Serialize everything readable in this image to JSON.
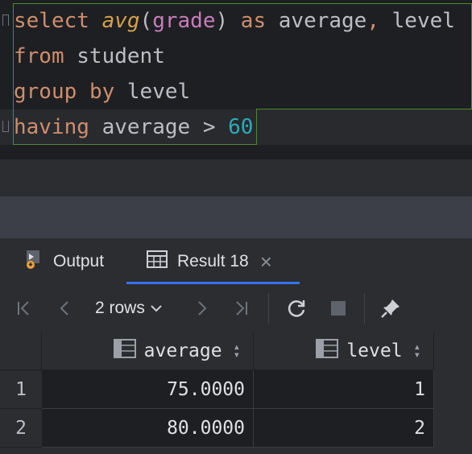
{
  "editor": {
    "line1": {
      "kw_select": "select",
      "fn": "avg",
      "paren_open": "(",
      "col": "grade",
      "paren_close": ")",
      "kw_as": "as",
      "alias": "average",
      "comma": ",",
      "col2": "level"
    },
    "line2": {
      "kw_from": "from",
      "table": "student"
    },
    "line3": {
      "kw_group": "group",
      "kw_by": "by",
      "col": "level"
    },
    "line4": {
      "kw_having": "having",
      "ident": "average",
      "op": ">",
      "num": "60"
    }
  },
  "tabs": [
    {
      "label": "Output",
      "icon": "output-icon"
    },
    {
      "label": "Result 18",
      "icon": "table-icon",
      "close": "×"
    }
  ],
  "toolbar": {
    "rows_label": "2 rows",
    "icons": [
      "first-page-icon",
      "prev-page-icon",
      "next-page-icon",
      "last-page-icon",
      "refresh-icon",
      "stop-icon",
      "pin-icon"
    ]
  },
  "grid": {
    "columns": [
      "average",
      "level"
    ],
    "rows": [
      {
        "num": "1",
        "average": "75.0000",
        "level": "1"
      },
      {
        "num": "2",
        "average": "80.0000",
        "level": "2"
      }
    ]
  },
  "colors": {
    "accent": "#3574f0",
    "keyword": "#cf8e6d",
    "number": "#2aacb8",
    "selection_border": "#4e8a2e"
  }
}
